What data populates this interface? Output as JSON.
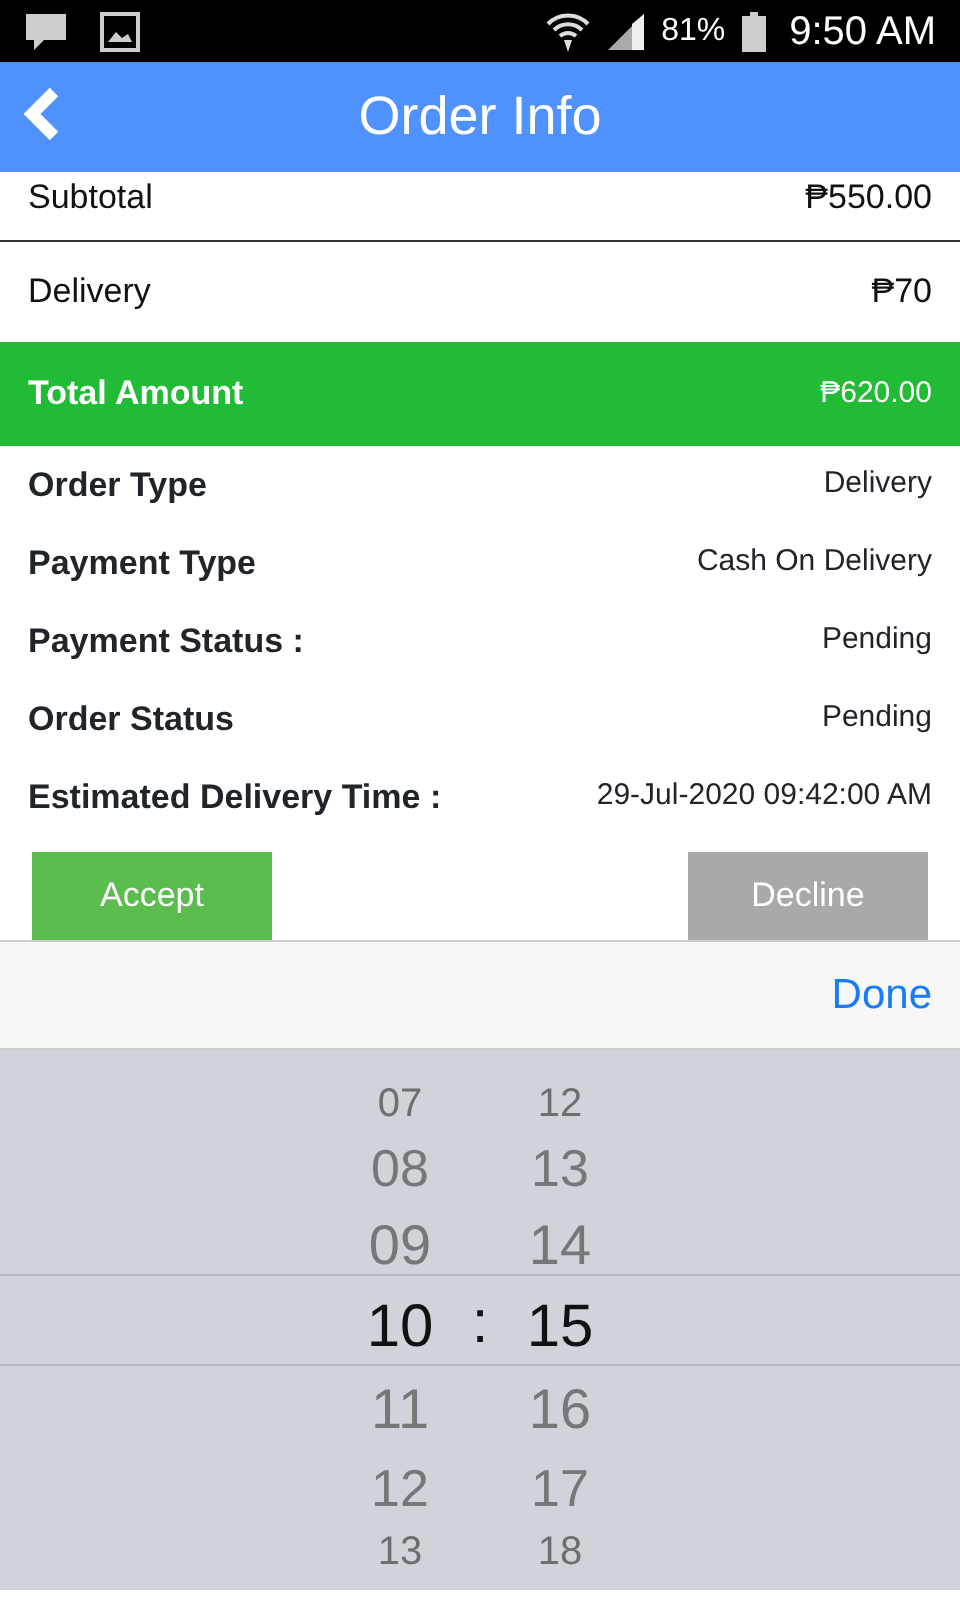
{
  "status_bar": {
    "battery": "81%",
    "time": "9:50 AM"
  },
  "header": {
    "title": "Order Info"
  },
  "summary": [
    {
      "label": "Subtotal",
      "value": "₱550.00",
      "kind": "plain"
    },
    {
      "label": "Delivery",
      "value": "₱70",
      "kind": "plain"
    },
    {
      "label": "Total Amount",
      "value": "₱620.00",
      "kind": "total"
    }
  ],
  "details": [
    {
      "label": "Order Type",
      "value": "Delivery"
    },
    {
      "label": "Payment Type",
      "value": "Cash On Delivery"
    },
    {
      "label": "Payment Status :",
      "value": "Pending"
    },
    {
      "label": "Order Status",
      "value": "Pending"
    },
    {
      "label": "Estimated Delivery Time :",
      "value": "29-Jul-2020 09:42:00 AM"
    }
  ],
  "buttons": [
    {
      "label": "Accept",
      "kind": "accept"
    },
    {
      "label": "Decline",
      "kind": "decline"
    }
  ],
  "picker_toolbar": {
    "done": "Done"
  },
  "picker": {
    "separator": ":",
    "hours": [
      {
        "label": "07",
        "selected": false
      },
      {
        "label": "08",
        "selected": false
      },
      {
        "label": "09",
        "selected": false
      },
      {
        "label": "10",
        "selected": true
      },
      {
        "label": "11",
        "selected": false
      },
      {
        "label": "12",
        "selected": false
      },
      {
        "label": "13",
        "selected": false
      }
    ],
    "minutes": [
      {
        "label": "12",
        "selected": false
      },
      {
        "label": "13",
        "selected": false
      },
      {
        "label": "14",
        "selected": false
      },
      {
        "label": "15",
        "selected": true
      },
      {
        "label": "16",
        "selected": false
      },
      {
        "label": "17",
        "selected": false
      },
      {
        "label": "18",
        "selected": false
      }
    ]
  }
}
